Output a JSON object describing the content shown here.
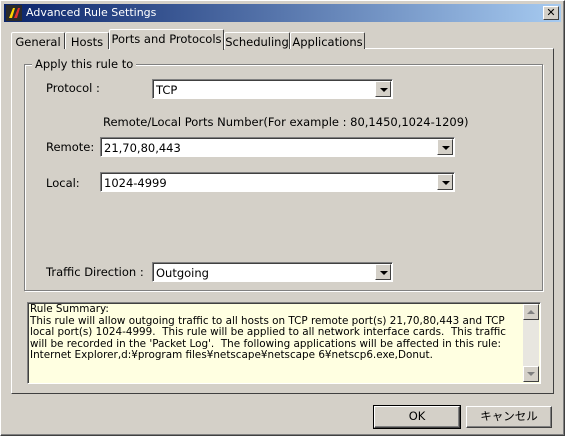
{
  "window": {
    "title": "Advanced Rule Settings",
    "close_label": "✕"
  },
  "tabs": [
    {
      "label": "General"
    },
    {
      "label": "Hosts"
    },
    {
      "label": "Ports and Protocols"
    },
    {
      "label": "Scheduling"
    },
    {
      "label": "Applications"
    }
  ],
  "active_tab": "Ports and Protocols",
  "group": {
    "legend": "Apply this rule to",
    "protocol_label": "Protocol :",
    "protocol_value": "TCP",
    "ports_hint": "Remote/Local Ports Number(For example : 80,1450,1024-1209)",
    "remote_label": "Remote:",
    "remote_value": "21,70,80,443",
    "local_label": "Local:",
    "local_value": "1024-4999",
    "direction_label": "Traffic Direction :",
    "direction_value": "Outgoing"
  },
  "summary": {
    "text": "Rule Summary:\nThis rule will allow outgoing traffic to all hosts on TCP remote port(s) 21,70,80,443 and TCP\nlocal port(s) 1024-4999.  This rule will be applied to all network interface cards.  This traffic\nwill be recorded in the 'Packet Log'.  The following applications will be affected in this rule:\nInternet Explorer,d:¥program files¥netscape¥netscape 6¥netscp6.exe,Donut."
  },
  "buttons": {
    "ok": "OK",
    "cancel": "キャンセル"
  }
}
